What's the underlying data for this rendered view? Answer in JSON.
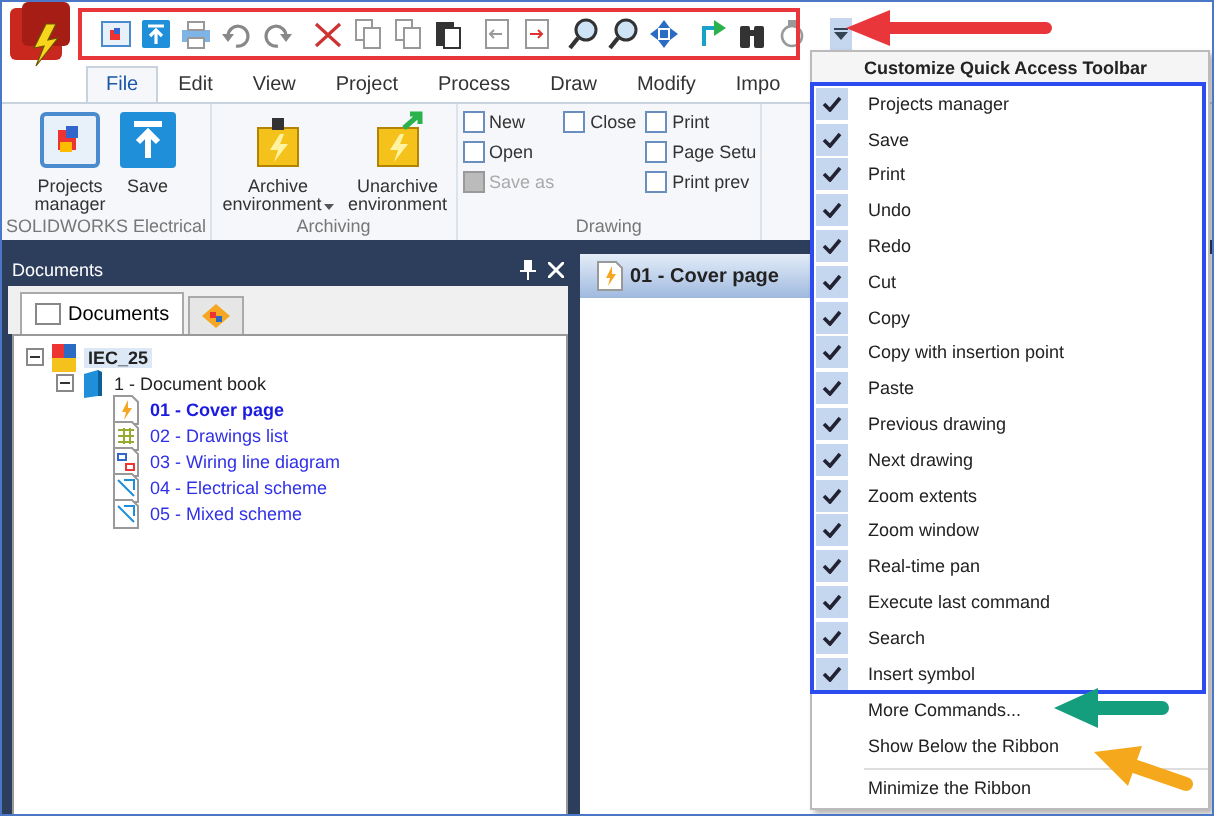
{
  "ribbon_tabs": [
    {
      "label": "File",
      "selected": true
    },
    {
      "label": "Edit",
      "selected": false
    },
    {
      "label": "View",
      "selected": false
    },
    {
      "label": "Project",
      "selected": false
    },
    {
      "label": "Process",
      "selected": false
    },
    {
      "label": "Draw",
      "selected": false
    },
    {
      "label": "Modify",
      "selected": false
    },
    {
      "label": "Impo",
      "selected": false
    }
  ],
  "ribbon_groups": [
    {
      "label": "SOLIDWORKS Electrical",
      "kind": "large",
      "buttons": [
        {
          "label": "Projects manager",
          "dropdown": false
        },
        {
          "label": "Save",
          "dropdown": false
        }
      ]
    },
    {
      "label": "Archiving",
      "kind": "large",
      "buttons": [
        {
          "label": "Archive environment",
          "dropdown": true
        },
        {
          "label": "Unarchive environment",
          "dropdown": false
        }
      ]
    },
    {
      "label": "Drawing",
      "kind": "small",
      "columns": [
        [
          {
            "label": "New",
            "disabled": false
          },
          {
            "label": "Open",
            "disabled": false
          },
          {
            "label": "Save as",
            "disabled": true
          }
        ],
        [
          {
            "label": "Close",
            "disabled": false
          }
        ],
        [
          {
            "label": "Print",
            "disabled": false
          },
          {
            "label": "Page Setu",
            "disabled": false
          },
          {
            "label": "Print prev",
            "disabled": false
          }
        ]
      ]
    }
  ],
  "documents_panel": {
    "title": "Documents",
    "tabs": [
      {
        "label": "Documents",
        "selected": true
      },
      {
        "selected": false
      }
    ],
    "tree": [
      {
        "label": "IEC_25",
        "selected": true,
        "expanded": true,
        "children": [
          {
            "label": "1 - Document book",
            "selected": false,
            "expanded": true,
            "children": [
              {
                "label": "01 - Cover page",
                "selected": true
              },
              {
                "label": "02 - Drawings list",
                "selected": false
              },
              {
                "label": "03 - Wiring line diagram",
                "selected": false
              },
              {
                "label": "04 - Electrical scheme",
                "selected": false
              },
              {
                "label": "05 - Mixed scheme",
                "selected": false
              }
            ]
          }
        ]
      }
    ]
  },
  "document_tab": {
    "label": "01 - Cover page"
  },
  "qat_menu": {
    "title": "Customize Quick Access Toolbar",
    "items": [
      {
        "label": "Projects manager",
        "checked": true
      },
      {
        "label": "Save",
        "checked": true
      },
      {
        "label": "Print",
        "checked": true
      },
      {
        "label": "Undo",
        "checked": true
      },
      {
        "label": "Redo",
        "checked": true
      },
      {
        "label": "Cut",
        "checked": true
      },
      {
        "label": "Copy",
        "checked": true
      },
      {
        "label": "Copy with insertion point",
        "checked": true
      },
      {
        "label": "Paste",
        "checked": true
      },
      {
        "label": "Previous drawing",
        "checked": true
      },
      {
        "label": "Next drawing",
        "checked": true
      },
      {
        "label": "Zoom extents",
        "checked": true
      },
      {
        "label": "Zoom window",
        "checked": true
      },
      {
        "label": "Real-time pan",
        "checked": true
      },
      {
        "label": "Execute last command",
        "checked": true
      },
      {
        "label": "Search",
        "checked": true
      },
      {
        "label": "Insert symbol",
        "checked": true
      }
    ],
    "commands": [
      "More Commands...",
      "Show Below the Ribbon",
      "Minimize the Ribbon"
    ]
  }
}
